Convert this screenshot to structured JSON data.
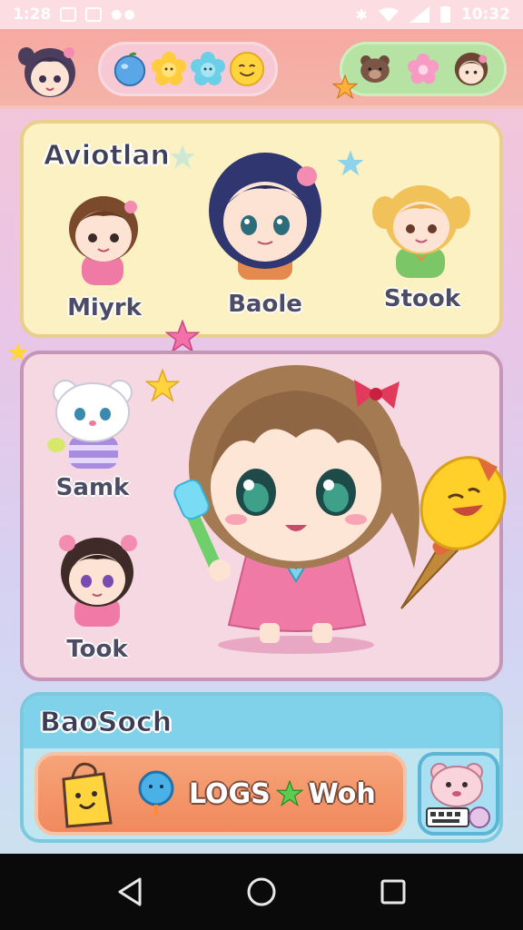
{
  "status_bar": {
    "time_left": "1:28",
    "time_right": "10:32"
  },
  "header": {
    "left_pill_icons": [
      "apple-icon",
      "flower-icon",
      "flower-icon",
      "smiley-icon"
    ],
    "right_pill_icons": [
      "bear-icon",
      "flower-icon",
      "avatar-icon"
    ]
  },
  "cast_panel": {
    "title": "Aviotlan",
    "characters": [
      {
        "name": "Miyrk"
      },
      {
        "name": "Baole"
      },
      {
        "name": "Stook"
      }
    ]
  },
  "stage_panel": {
    "side_characters": [
      {
        "name": "Samk"
      },
      {
        "name": "Took"
      }
    ]
  },
  "bottom_panel": {
    "title": "BaoSoch",
    "action_text_1": "LOGS",
    "action_text_2": "Woh"
  },
  "colors": {
    "header_bg": "#f6a9a1",
    "cast_panel_bg": "#fbf1c2",
    "stage_panel_bg": "#f5d8e2",
    "bottom_panel_bg": "#bfe6f0",
    "action_button": "#f08a5c"
  }
}
